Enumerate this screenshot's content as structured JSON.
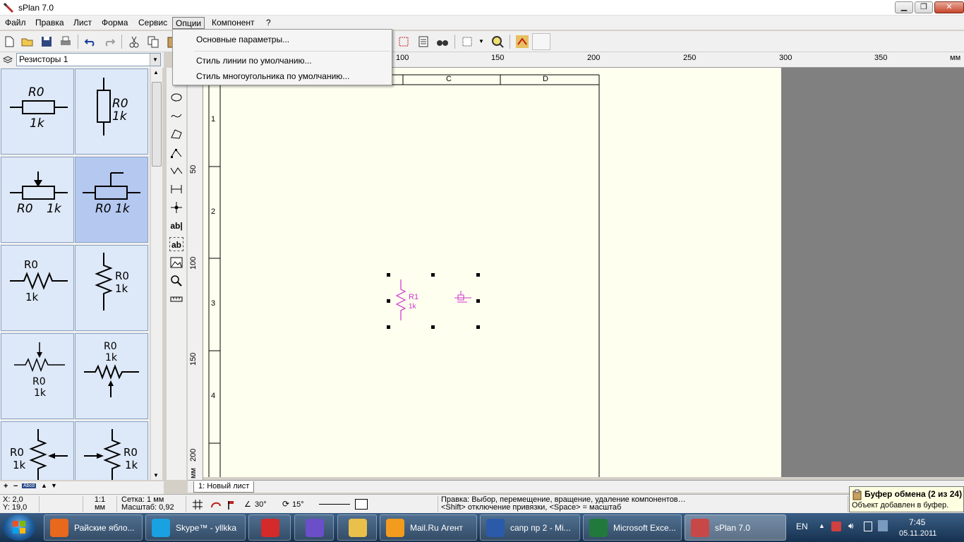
{
  "window": {
    "title": "sPlan 7.0"
  },
  "menu": {
    "items": [
      "Файл",
      "Правка",
      "Лист",
      "Форма",
      "Сервис",
      "Опции",
      "Компонент",
      "?"
    ],
    "open_index": 5
  },
  "options_menu": {
    "items": [
      "Основные параметры...",
      "Стиль линии по умолчанию...",
      "Стиль многоугольника по умолчанию..."
    ]
  },
  "library": {
    "selected": "Резисторы 1",
    "bottom_label": "Abcd"
  },
  "ruler": {
    "unit": "мм",
    "h_labels": [
      "100",
      "150",
      "200",
      "250",
      "300",
      "350"
    ],
    "v_labels": [
      "50",
      "100",
      "150",
      "200"
    ],
    "v_unit": "мм"
  },
  "sheet": {
    "columns": [
      "C",
      "D"
    ],
    "rows": [
      "1",
      "2",
      "3",
      "4"
    ],
    "tab": "1: Новый лист",
    "component": {
      "ref": "R1",
      "value": "1k"
    }
  },
  "status": {
    "x": "X: 2,0",
    "y": "Y: 19,0",
    "scale_top": "1:1",
    "scale_bottom": "мм",
    "grid": "Сетка: 1 мм",
    "zoom": "Масштаб:  0,92",
    "angle1": "30°",
    "angle2": "15°",
    "hint1": "Правка: Выбор, перемещение, вращение, удаление компонентов…",
    "hint2": "<Shift> отключение привязки, <Space> = масштаб"
  },
  "clipboard": {
    "title": "Буфер обмена (2 из 24)",
    "message": "Объект добавлен в буфер."
  },
  "taskbar": {
    "tasks": [
      {
        "label": "Райские ябло...",
        "color": "#e8681e"
      },
      {
        "label": "Skype™ - yllkka",
        "color": "#1aa1e1"
      },
      {
        "label": "",
        "color": "#d42a2a"
      },
      {
        "label": "",
        "color": "#6a4fc8"
      },
      {
        "label": "",
        "color": "#e8c04a"
      },
      {
        "label": "Mail.Ru Агент",
        "color": "#f29b1c"
      },
      {
        "label": "сапр пр 2 - Mi...",
        "color": "#2a5aa8"
      },
      {
        "label": "Microsoft Exce...",
        "color": "#217a3c"
      },
      {
        "label": "sPlan 7.0",
        "color": "#c84848"
      }
    ],
    "lang": "EN",
    "time": "7:45",
    "date": "05.11.2011"
  },
  "colors": {
    "component": "#cc33cc",
    "sheet": "#fffff0",
    "workspace": "#808080"
  }
}
